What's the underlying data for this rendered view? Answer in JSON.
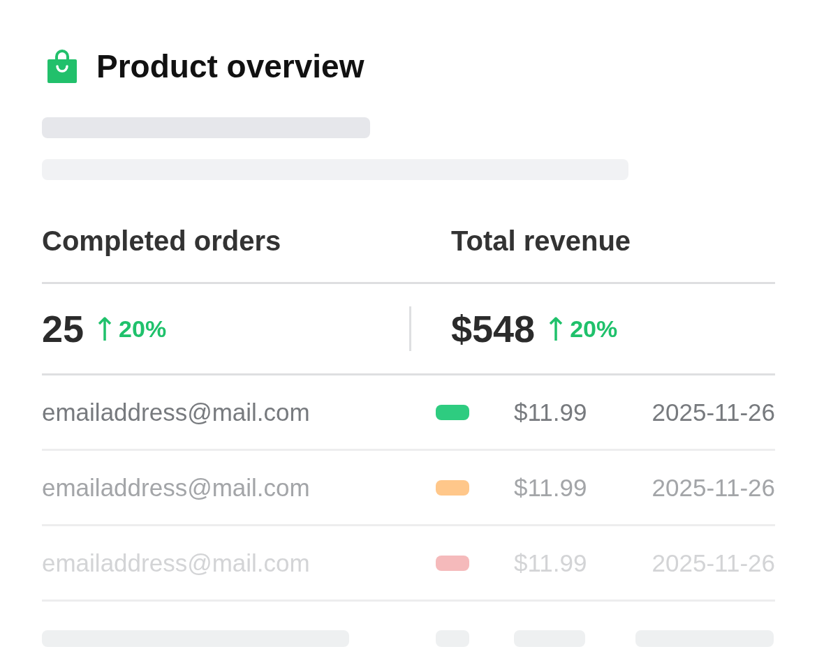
{
  "title": "Product overview",
  "stats": [
    {
      "label": "Completed orders",
      "value": "25",
      "change": "20%"
    },
    {
      "label": "Total revenue",
      "value": "$548",
      "change": "20%"
    }
  ],
  "orders": [
    {
      "email": "emailaddress@mail.com",
      "color": "#2ecc80",
      "amount": "$11.99",
      "date": "2025-11-26"
    },
    {
      "email": "emailaddress@mail.com",
      "color": "#ffc78a",
      "amount": "$11.99",
      "date": "2025-11-26"
    },
    {
      "email": "emailaddress@mail.com",
      "color": "#f5babb",
      "amount": "$11.99",
      "date": "2025-11-26"
    }
  ]
}
